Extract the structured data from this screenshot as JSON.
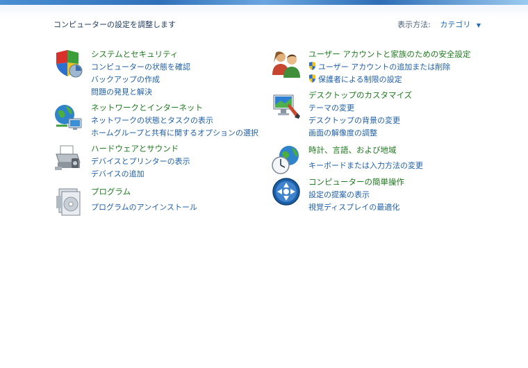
{
  "window": {
    "title": "コンピューターの設定を調整します"
  },
  "view_by": {
    "label": "表示方法:",
    "value": "カテゴリ",
    "caret": "▼"
  },
  "categories": {
    "system": {
      "title": "システムとセキュリティ",
      "links": [
        "コンピューターの状態を確認",
        "バックアップの作成",
        "問題の発見と解決"
      ],
      "icon": "shield-icon"
    },
    "network": {
      "title": "ネットワークとインターネット",
      "links": [
        "ネットワークの状態とタスクの表示",
        "ホームグループと共有に関するオプションの選択"
      ],
      "icon": "network-globe-icon"
    },
    "hardware": {
      "title": "ハードウェアとサウンド",
      "links": [
        "デバイスとプリンターの表示",
        "デバイスの追加"
      ],
      "icon": "printer-icon"
    },
    "programs": {
      "title": "プログラム",
      "links": [
        "プログラムのアンインストール"
      ],
      "icon": "programs-icon"
    },
    "users": {
      "title": "ユーザー アカウントと家族のための安全設定",
      "links": [
        "ユーザー アカウントの追加または削除",
        "保護者による制限の設定"
      ],
      "icon": "users-icon"
    },
    "appearance": {
      "title": "デスクトップのカスタマイズ",
      "links": [
        "テーマの変更",
        "デスクトップの背景の変更",
        "画面の解像度の調整"
      ],
      "icon": "desktop-brush-icon"
    },
    "clock": {
      "title": "時計、言語、および地域",
      "links": [
        "キーボードまたは入力方法の変更"
      ],
      "icon": "clock-globe-icon"
    },
    "ease": {
      "title": "コンピューターの簡単操作",
      "links": [
        "設定の提案の表示",
        "視覚ディスプレイの最適化"
      ],
      "icon": "ease-of-access-icon"
    }
  },
  "colors": {
    "category_title": "#1e7a1e",
    "link": "#1e5fa8",
    "header_text": "#1e395b",
    "topbar": "#2f6fb8"
  }
}
